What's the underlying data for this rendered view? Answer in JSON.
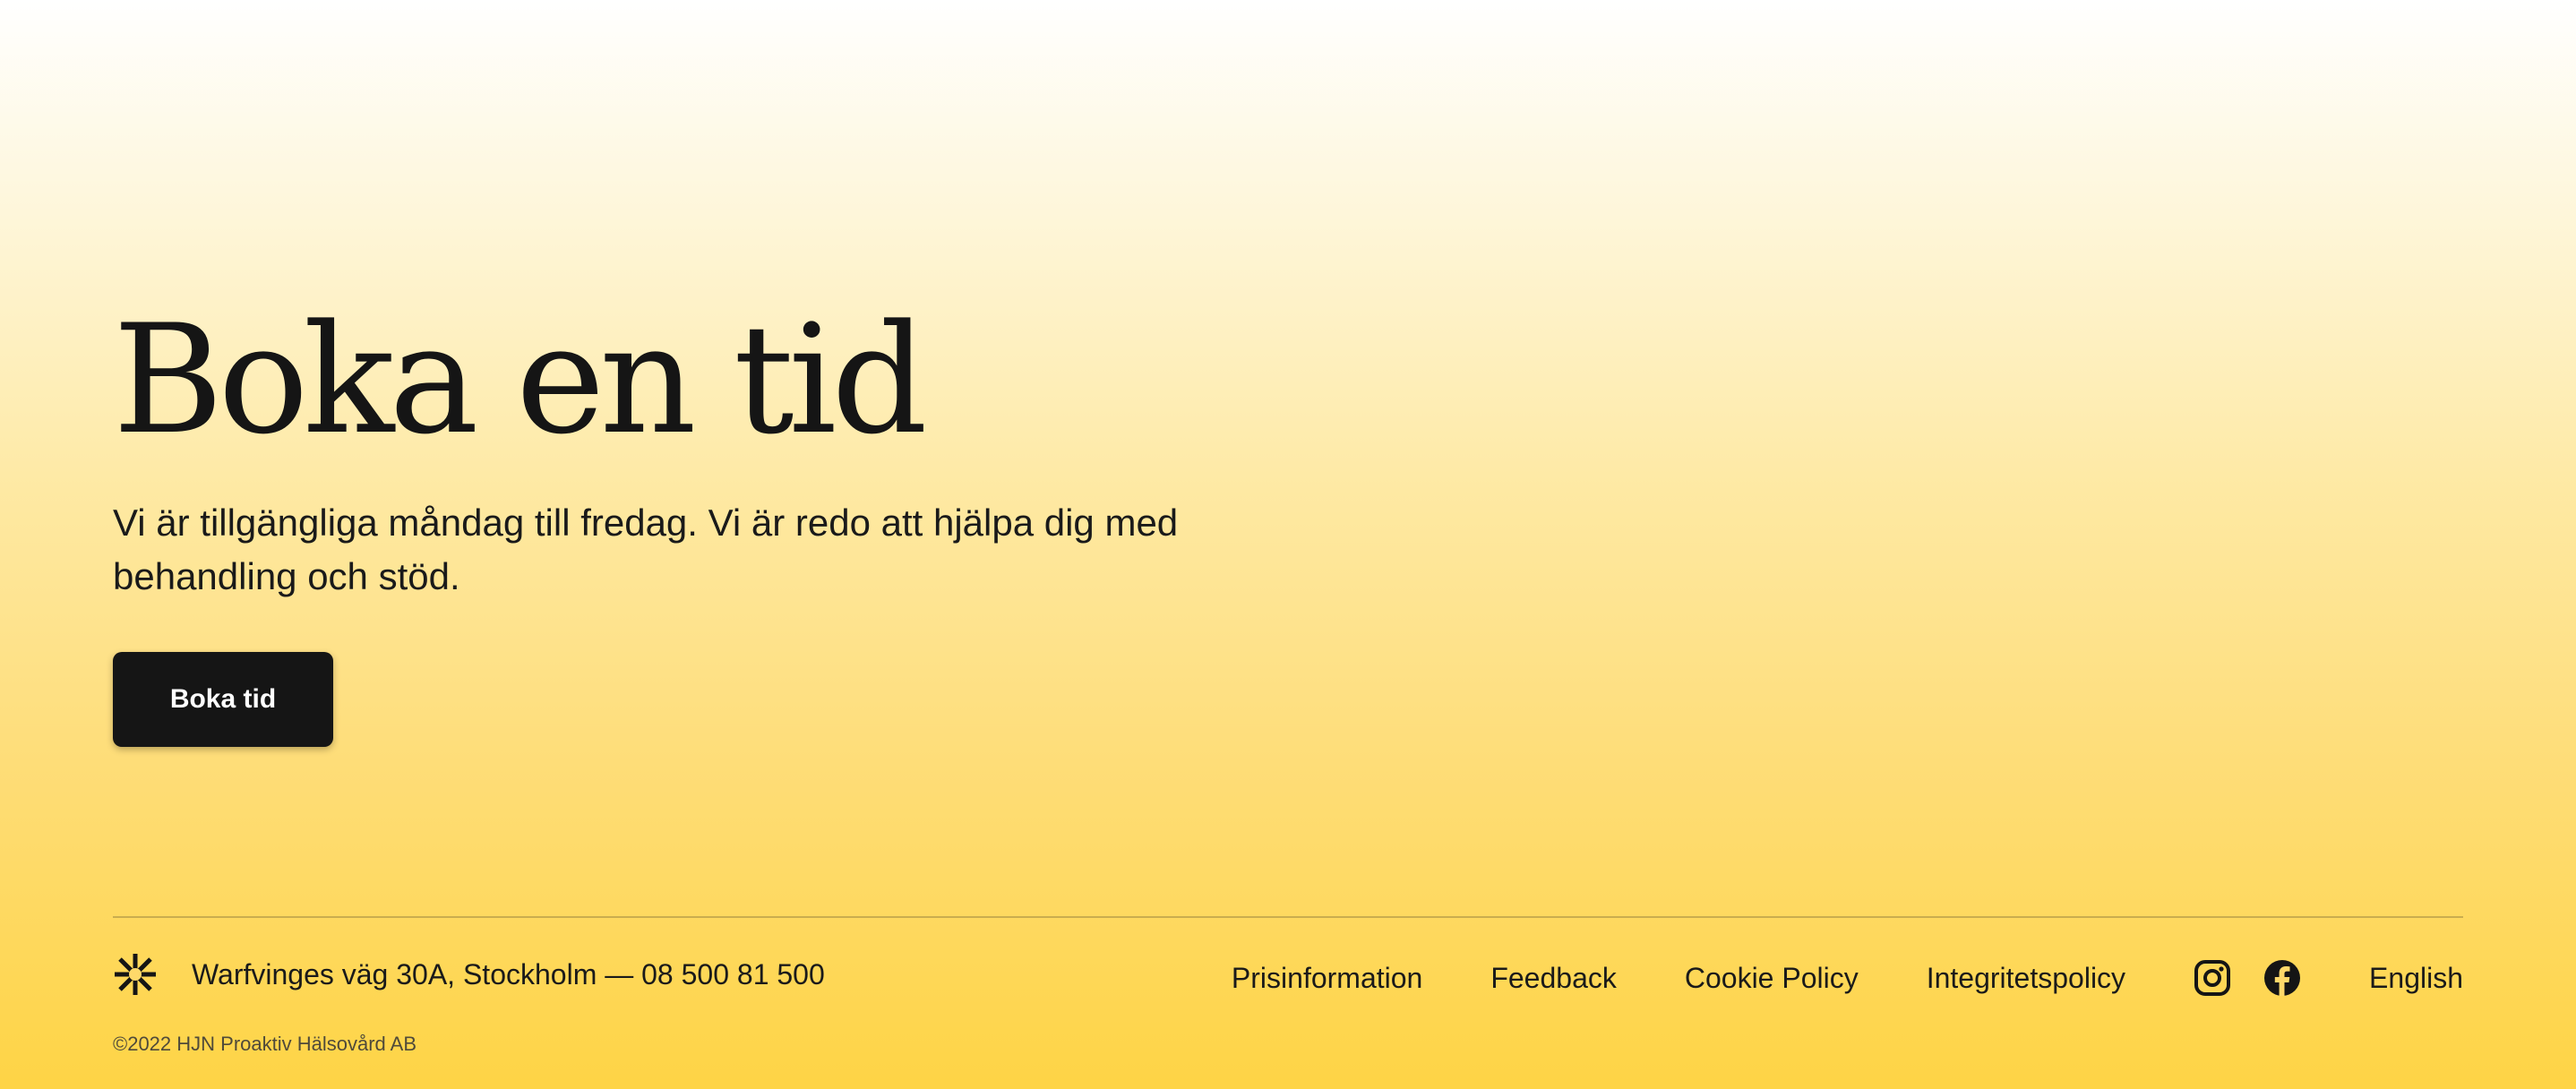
{
  "hero": {
    "title": "Boka en tid",
    "subtitle": "Vi är tillgängliga måndag till fredag. Vi är redo att hjälpa dig med behandling och stöd.",
    "cta_label": "Boka tid"
  },
  "footer": {
    "logo_icon": "asterisk-logo-icon",
    "address": "Warfvinges väg 30A, Stockholm — 08 500 81 500",
    "copyright": "©2022 HJN Proaktiv Hälsovård AB",
    "links": [
      {
        "label": "Prisinformation"
      },
      {
        "label": "Feedback"
      },
      {
        "label": "Cookie Policy"
      },
      {
        "label": "Integritetspolicy"
      }
    ],
    "social": [
      {
        "icon": "instagram-icon"
      },
      {
        "icon": "facebook-icon"
      }
    ],
    "language": "English"
  },
  "colors": {
    "background_top": "#ffffff",
    "background_bottom": "#fed445",
    "text": "#141414",
    "button_bg": "#151515",
    "button_text": "#ffffff"
  }
}
